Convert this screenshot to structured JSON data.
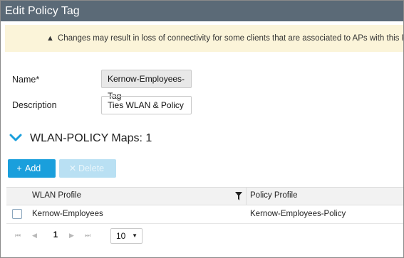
{
  "window": {
    "title": "Edit Policy Tag"
  },
  "warning": {
    "icon": "warning-triangle-icon",
    "text": "Changes may result in loss of connectivity for some clients that are associated to APs with this Policy Tag."
  },
  "form": {
    "name_label": "Name*",
    "name_value": "Kernow-Employees-Tag",
    "description_label": "Description",
    "description_value": "Ties WLAN & Policy"
  },
  "section": {
    "icon": "chevron-down-icon",
    "title": "WLAN-POLICY Maps: 1"
  },
  "toolbar": {
    "add_icon": "plus-icon",
    "add_label": "Add",
    "delete_icon": "close-icon",
    "delete_label": "Delete"
  },
  "grid": {
    "columns": [
      "WLAN Profile",
      "Policy Profile"
    ],
    "rows": [
      {
        "wlan_profile": "Kernow-Employees",
        "policy_profile": "Kernow-Employees-Policy"
      }
    ]
  },
  "pager": {
    "first": "⏮",
    "prev": "◀",
    "page": "1",
    "next": "▶",
    "last": "⏭",
    "page_size": "10"
  },
  "colors": {
    "titlebar": "#5b6a77",
    "accent": "#1a9fdc",
    "warning_bg": "#fbf4d9"
  }
}
